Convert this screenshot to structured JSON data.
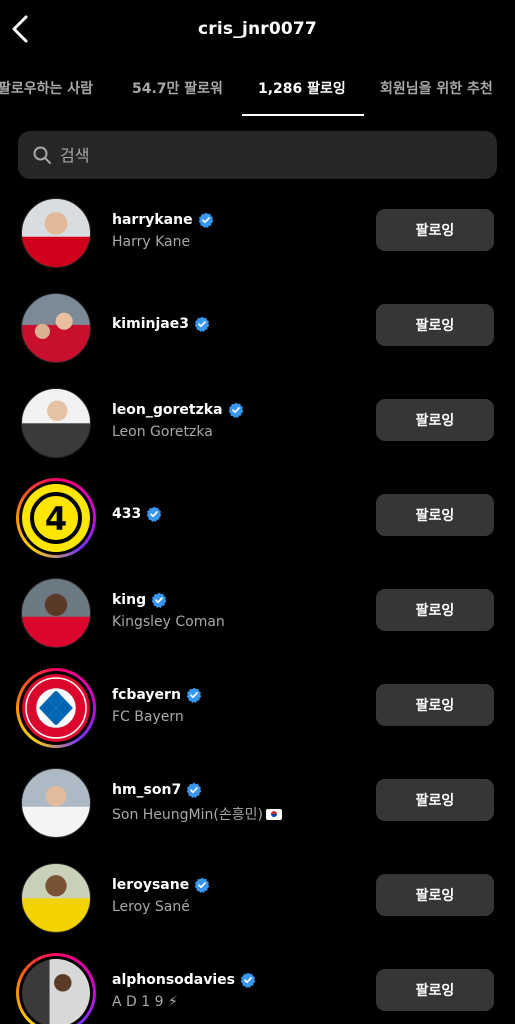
{
  "header": {
    "title": "cris_jnr0077"
  },
  "tabs": [
    {
      "label": "팔로우하는 사람"
    },
    {
      "label": "54.7만 팔로워"
    },
    {
      "label": "1,286 팔로잉"
    },
    {
      "label": "회원님을 위한 추천"
    }
  ],
  "search": {
    "placeholder": "검색"
  },
  "accent": {
    "verified": "#3897f0",
    "button": "#363636",
    "field": "#262626"
  },
  "following": [
    {
      "username": "harrykane",
      "fullname": "Harry Kane",
      "button": "팔로잉"
    },
    {
      "username": "kiminjae3",
      "fullname": "",
      "button": "팔로잉"
    },
    {
      "username": "leon_goretzka",
      "fullname": "Leon Goretzka",
      "button": "팔로잉"
    },
    {
      "username": "433",
      "fullname": "",
      "button": "팔로잉"
    },
    {
      "username": "king",
      "fullname": "Kingsley Coman",
      "button": "팔로잉"
    },
    {
      "username": "fcbayern",
      "fullname": "FC Bayern",
      "button": "팔로잉"
    },
    {
      "username": "hm_son7",
      "fullname": "Son HeungMin(손흥민)",
      "button": "팔로잉"
    },
    {
      "username": "leroysane",
      "fullname": "Leroy Sané",
      "button": "팔로잉"
    },
    {
      "username": "alphonsodavies",
      "fullname": "A D 1 9 ⚡",
      "button": "팔로잉"
    }
  ]
}
